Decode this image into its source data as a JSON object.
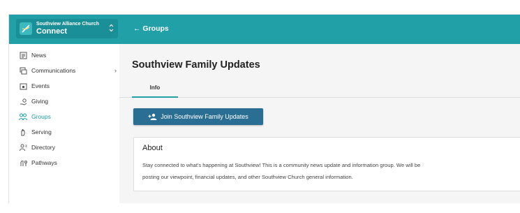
{
  "header": {
    "org_name": "Southview Alliance Church",
    "app_name": "Connect",
    "back_link": "← Groups",
    "brand_color": "#21a0a8"
  },
  "sidebar": {
    "items": [
      {
        "label": "News",
        "icon": "news-icon"
      },
      {
        "label": "Communications",
        "icon": "communications-icon",
        "has_submenu": true
      },
      {
        "label": "Events",
        "icon": "events-icon"
      },
      {
        "label": "Giving",
        "icon": "giving-icon"
      },
      {
        "label": "Groups",
        "icon": "groups-icon",
        "active": true
      },
      {
        "label": "Serving",
        "icon": "serving-icon"
      },
      {
        "label": "Directory",
        "icon": "directory-icon"
      },
      {
        "label": "Pathways",
        "icon": "pathways-icon"
      }
    ],
    "active_color": "#1c9aa3"
  },
  "main": {
    "title": "Southview Family Updates",
    "tabs": [
      {
        "label": "Info",
        "active": true
      }
    ],
    "join_button": "Join Southview Family Updates",
    "join_button_color": "#2a6f93",
    "about": {
      "heading": "About",
      "text_line1": "Stay connected to what's happening at Southview! This is a community news update and information group. We will be",
      "text_line2": "posting our viewpoint, financial updates, and other Southview Church general information."
    }
  }
}
